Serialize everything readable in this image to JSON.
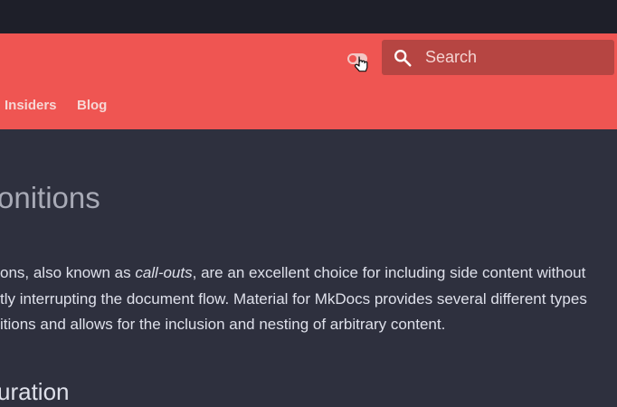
{
  "header": {
    "search": {
      "placeholder": "Search",
      "icon": "search-icon"
    },
    "palette_toggle_icon": "toggle-icon",
    "tabs": [
      {
        "label": "Insiders"
      },
      {
        "label": "Blog"
      }
    ]
  },
  "content": {
    "title": "onitions",
    "paragraph": {
      "line1_start": "ons, also known as ",
      "line1_em": "call-outs",
      "line1_end": ", are an excellent choice for including side content without",
      "line2": "tly interrupting the document flow. Material for MkDocs provides several different types",
      "line3": "itions and allows for the inclusion and nesting of arbitrary content."
    },
    "subheading": "uration"
  },
  "colors": {
    "primary": "#ef5552",
    "top_strip": "#1e1f29",
    "background": "#2e303e",
    "search_bg": "#b64542"
  }
}
